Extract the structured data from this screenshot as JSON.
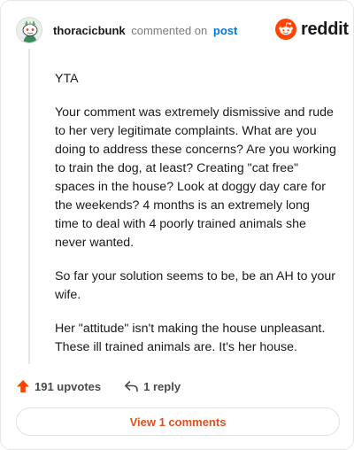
{
  "header": {
    "username": "thoracicbunk",
    "verb": "commented on",
    "post_link": "post",
    "brand": "reddit"
  },
  "comment": {
    "paragraphs": [
      "YTA",
      "Your comment was extremely dismissive and rude to her very legitimate complaints. What are you doing to address these concerns? Are you working to train the dog, at least? Creating \"cat free\" spaces in the house? Look at doggy day care for the weekends? 4 months is an extremely long time to deal with 4 poorly trained animals she never wanted.",
      "So far your solution seems to be, be an AH to your wife.",
      "Her \"attitude\" isn't making the house unpleasant. These ill trained animals are. It's her house."
    ]
  },
  "actions": {
    "upvotes": "191 upvotes",
    "replies": "1 reply"
  },
  "footer": {
    "view_comments": "View 1 comments"
  },
  "colors": {
    "brand_orange": "#ff4500",
    "link_blue": "#0079d3",
    "view_comments_orange": "#e0521d"
  },
  "icons": {
    "avatar": "snoo-avatar",
    "brand": "reddit-snoo-icon",
    "upvote": "upvote-arrow-icon",
    "reply": "reply-arrow-icon"
  }
}
